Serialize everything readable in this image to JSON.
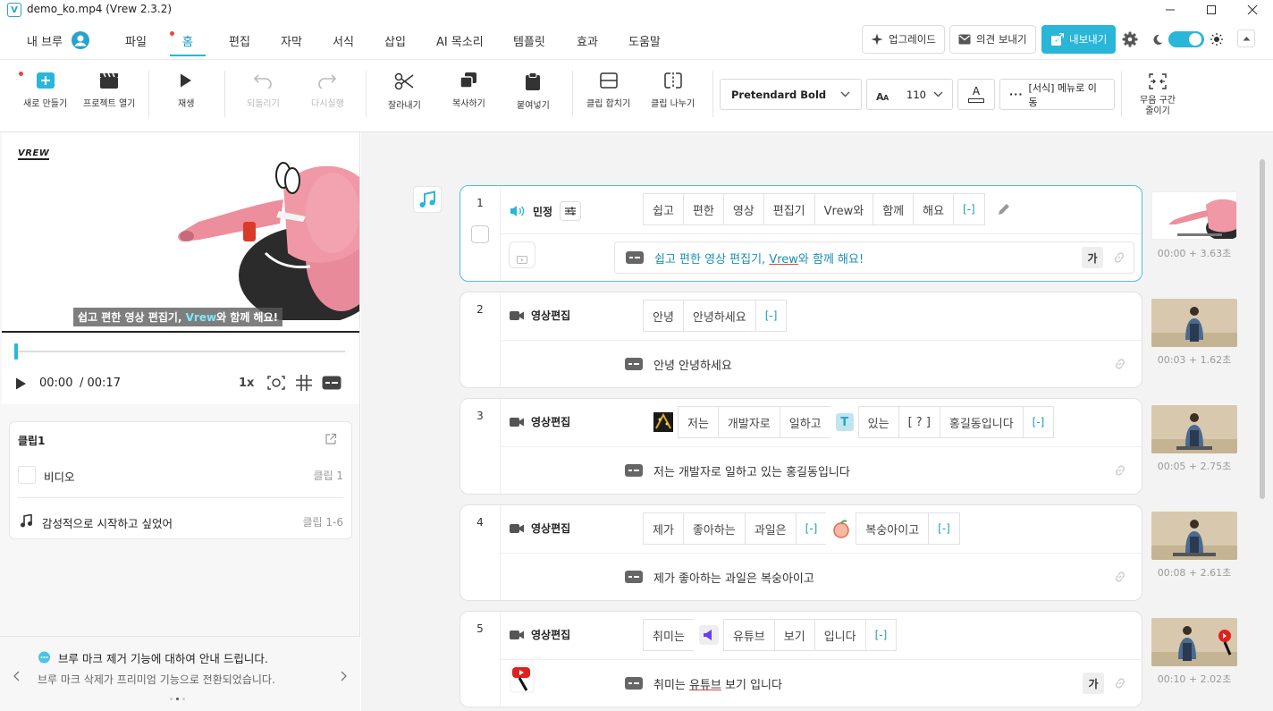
{
  "window": {
    "title": "demo_ko.mp4 (Vrew 2.3.2)",
    "logo": "V"
  },
  "menu": {
    "account": "내 브루",
    "tabs": [
      "파일",
      "홈",
      "편집",
      "자막",
      "서식",
      "삽입",
      "AI 목소리",
      "템플릿",
      "효과",
      "도움말"
    ],
    "active": "홈",
    "upgrade": "업그레이드",
    "feedback": "의견 보내기",
    "export": "내보내기"
  },
  "toolbar": {
    "new_project": "새로 만들기",
    "open_project": "프로젝트 열기",
    "play": "재생",
    "undo": "되돌리기",
    "redo": "다시실행",
    "cut": "잘라내기",
    "copy": "복사하기",
    "paste": "붙여넣기",
    "merge_clip": "클립 합치기",
    "split_clip": "클립 나누기",
    "font_name": "Pretendard Bold",
    "font_size": "110",
    "font_color_glyph": "A",
    "format_menu": "[서식] 메뉴로 이동",
    "shorten_silence_1": "무음 구간",
    "shorten_silence_2": "줄이기"
  },
  "preview": {
    "logo_text": "VREW",
    "subtitle_before": "쉽고 편한 영상 편집기,",
    "subtitle_highlight": "Vrew",
    "subtitle_after": "와 함께 해요!"
  },
  "player": {
    "current": "00:00",
    "total": "/ 00:17",
    "speed": "1x",
    "progress": 0.0
  },
  "clip_panel": {
    "title": "클립1",
    "video_label": "비디오",
    "video_value": "클립 1",
    "music_label": "감성적으로 시작하고 싶었어",
    "music_value": "클립 1-6"
  },
  "notice": {
    "title": "브루 마크 제거 기능에 대하여 안내 드립니다.",
    "body": "브루 마크 삭제가 프리미엄 기능으로 전환되었습니다."
  },
  "clips": [
    {
      "num": "1",
      "speaker": "민정",
      "words": [
        "쉽고",
        "편한",
        "영상",
        "편집기",
        "Vrew와",
        "함께",
        "해요",
        "[-]"
      ],
      "subtitle": "쉽고 편한 영상 편집기, Vrew와 함께 해요!",
      "subtitle_underlined": "Vrew",
      "time": "00:00 + 3.63초",
      "style_btn": "가"
    },
    {
      "num": "2",
      "speaker": "영상편집",
      "words": [
        "안녕",
        "안녕하세요",
        "[-]"
      ],
      "subtitle": "안녕 안녕하세요",
      "time": "00:03 + 1.62초"
    },
    {
      "num": "3",
      "speaker": "영상편집",
      "words": [
        "저는",
        "개발자로",
        "일하고",
        "있는",
        "[ ? ]",
        "홍길동입니다",
        "[-]"
      ],
      "subtitle": "저는 개발자로 일하고 있는 홍길동입니다",
      "time": "00:05 + 2.75초",
      "text_icon": "T"
    },
    {
      "num": "4",
      "speaker": "영상편집",
      "words": [
        "제가",
        "좋아하는",
        "과일은",
        "[-]",
        "복숭아이고",
        "[-]"
      ],
      "subtitle": "제가 좋아하는 과일은 복숭아이고",
      "time": "00:08 + 2.61초"
    },
    {
      "num": "5",
      "speaker": "영상편집",
      "words": [
        "취미는",
        "유튜브",
        "보기",
        "입니다",
        "[-]"
      ],
      "subtitle_before": "취미는 ",
      "subtitle_underlined": "유튜브",
      "subtitle_after": " 보기 입니다",
      "time": "00:10 + 2.02초",
      "style_btn": "가"
    }
  ]
}
